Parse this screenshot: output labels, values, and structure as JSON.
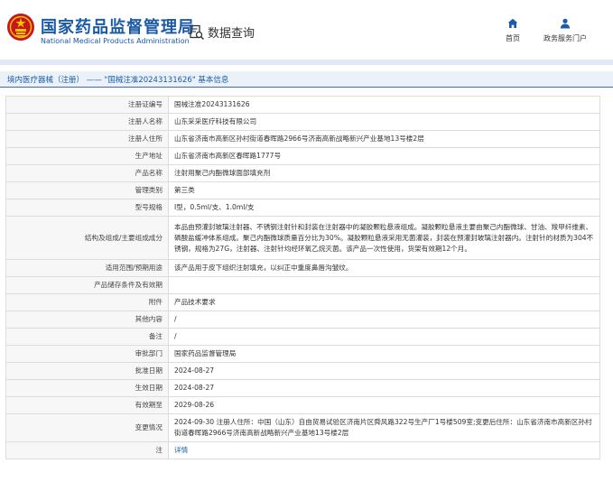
{
  "header": {
    "title_cn": "国家药品监督管理局",
    "title_en": "National Medical Products Administration",
    "query_label": "数据查询",
    "nav": [
      {
        "label": "首页",
        "icon": "home-icon"
      },
      {
        "label": "政务服务门户",
        "icon": "user-icon"
      }
    ]
  },
  "breadcrumb": {
    "category": "境内医疗器械（注册）",
    "separator": "——",
    "title": "\"国械注准20243131626\"  基本信息"
  },
  "detail_rows": [
    {
      "key": "注册证编号",
      "value": "国械注准20243131626"
    },
    {
      "key": "注册人名称",
      "value": "山东采采医疗科技有限公司"
    },
    {
      "key": "注册人住所",
      "value": "山东省济南市高新区孙村街道春晖路2966号济南高新战略新兴产业基地13号楼2层"
    },
    {
      "key": "生产地址",
      "value": "山东省济南市高新区春晖路1777号"
    },
    {
      "key": "产品名称",
      "value": "注射用聚己内酯微球面部填充剂"
    },
    {
      "key": "管理类别",
      "value": "第三类"
    },
    {
      "key": "型号规格",
      "value": "Ⅰ型，0.5ml/支、1.0ml/支"
    },
    {
      "key": "结构及组成/主要组成成分",
      "value": "本品由预灌封玻璃注射器、不锈钢注射针和封装在注射器中的凝胶颗粒悬液组成。凝胶颗粒悬液主要由聚己内酯微球、甘油、羧甲纤维素、磷酸盐缓冲体系组成。聚己内酯微球质量百分比为30%。凝胶颗粒悬液采用无菌灌装，封装在预灌封玻璃注射器内。注射针的材质为304不锈钢，规格为27G，注射器、注射针均经环氧乙烷灭菌。该产品一次性使用，货架有效期12个月。"
    },
    {
      "key": "适用范围/预期用途",
      "value": "该产品用于皮下组织注射填充，以纠正中重度鼻唇沟皱纹。"
    },
    {
      "key": "产品储存条件及有效期",
      "value": ""
    },
    {
      "key": "附件",
      "value": "产品技术要求"
    },
    {
      "key": "其他内容",
      "value": "/"
    },
    {
      "key": "备注",
      "value": "/"
    },
    {
      "key": "审批部门",
      "value": "国家药品监督管理局"
    },
    {
      "key": "批准日期",
      "value": "2024-08-27"
    },
    {
      "key": "生效日期",
      "value": "2024-08-27"
    },
    {
      "key": "有效期至",
      "value": "2029-08-26"
    },
    {
      "key": "变更情况",
      "value": "2024-09-30 注册人住所：中国（山东）自由贸易试验区济南片区舜风路322号生产厂1号楼509室;变更后住所：山东省济南市高新区孙村街道春晖路2966号济南高新战略新兴产业基地13号楼2层"
    },
    {
      "key": "注",
      "value": "详情"
    }
  ],
  "colors": {
    "brand": "#1a5aa6",
    "emblem_red": "#c8161d",
    "emblem_gold": "#f5c400"
  }
}
